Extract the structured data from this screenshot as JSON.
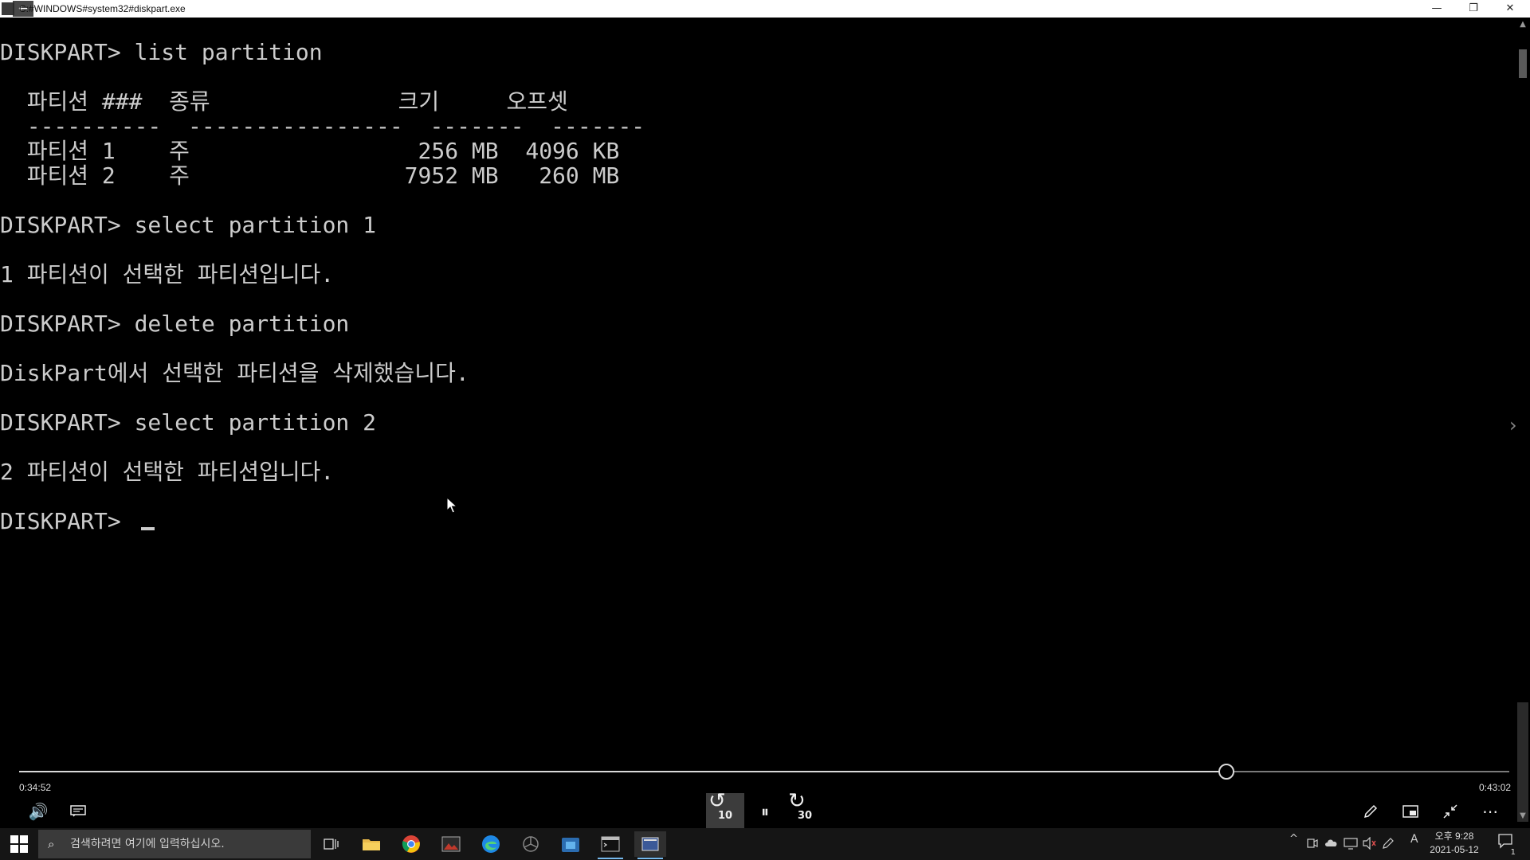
{
  "window": {
    "title": "C:#WINDOWS#system32#diskpart.exe",
    "back_glyph": "←",
    "minimize_glyph": "—",
    "maximize_glyph": "❐",
    "close_glyph": "✕"
  },
  "console": {
    "lines": [
      "DISKPART> list partition",
      "",
      "  파티션 ###  종류              크기     오프셋",
      "  ----------  ----------------  -------  -------",
      "  파티션 1    주                 256 MB  4096 KB",
      "  파티션 2    주                7952 MB   260 MB",
      "",
      "DISKPART> select partition 1",
      "",
      "1 파티션이 선택한 파티션입니다.",
      "",
      "DISKPART> delete partition",
      "",
      "DiskPart에서 선택한 파티션을 삭제했습니다.",
      "",
      "DISKPART> select partition 2",
      "",
      "2 파티션이 선택한 파티션입니다.",
      "",
      "DISKPART> "
    ]
  },
  "player": {
    "current_time": "0:34:52",
    "total_time": "0:43:02",
    "progress": 0.8103,
    "rewind_label": "10",
    "forward_label": "30",
    "pause_glyph": "⏸",
    "volume_glyph": "🔊",
    "more_glyph": "⋯",
    "icons": [
      "volume-icon",
      "captions-icon",
      "rewind-10-icon",
      "pause-icon",
      "forward-30-icon",
      "pen-icon",
      "mini-player-icon",
      "exit-fullscreen-icon",
      "more-icon"
    ]
  },
  "taskbar": {
    "search_placeholder": "검색하려면 여기에 입력하십시오.",
    "search_glyph": "⌕",
    "apps": [
      "task-view-icon",
      "file-explorer-icon",
      "chrome-icon",
      "photos-icon",
      "edge-icon",
      "app-icon",
      "store-icon",
      "terminal-icon",
      "movies-tv-icon"
    ],
    "tray": {
      "chevron": "^",
      "input_indicator": "A"
    },
    "clock_time": "오후 9:28",
    "clock_date": "2021-05-12",
    "notification_count": "1",
    "colors": {
      "accent": "#76b9ed"
    }
  }
}
